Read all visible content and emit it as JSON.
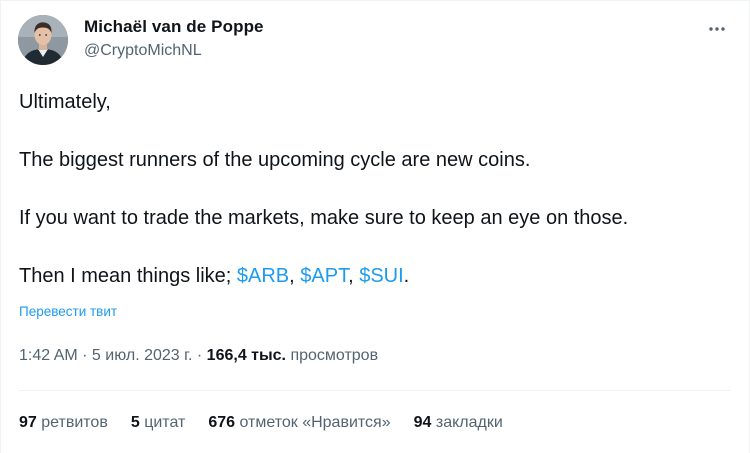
{
  "author": {
    "name": "Michaël van de Poppe",
    "handle": "@CryptoMichNL"
  },
  "tweet": {
    "line1": "Ultimately,",
    "line2": "The biggest runners of the upcoming cycle are new coins.",
    "line3": "If you want to trade the markets, make sure to keep an eye on those.",
    "line4_prefix": "Then I mean things like; ",
    "cashtags": [
      "$ARB",
      "$APT",
      "$SUI"
    ],
    "sep1": ", ",
    "sep2": ", ",
    "line4_suffix": "."
  },
  "translate_label": "Перевести твит",
  "meta": {
    "time": "1:42 AM",
    "dot1": " · ",
    "date": "5 июл. 2023 г.",
    "dot2": " · ",
    "views_count": "166,4 тыс.",
    "views_label": " просмотров"
  },
  "stats": [
    {
      "num": "97",
      "label": "ретвитов"
    },
    {
      "num": "5",
      "label": "цитат"
    },
    {
      "num": "676",
      "label": "отметок «Нравится»"
    },
    {
      "num": "94",
      "label": "закладки"
    }
  ],
  "colors": {
    "accent": "#1d9bf0",
    "text": "#0f1419",
    "secondary": "#536471",
    "border": "#eff3f4"
  },
  "icons": {
    "more": "more-horizontal-icon",
    "avatar": "user-avatar"
  }
}
